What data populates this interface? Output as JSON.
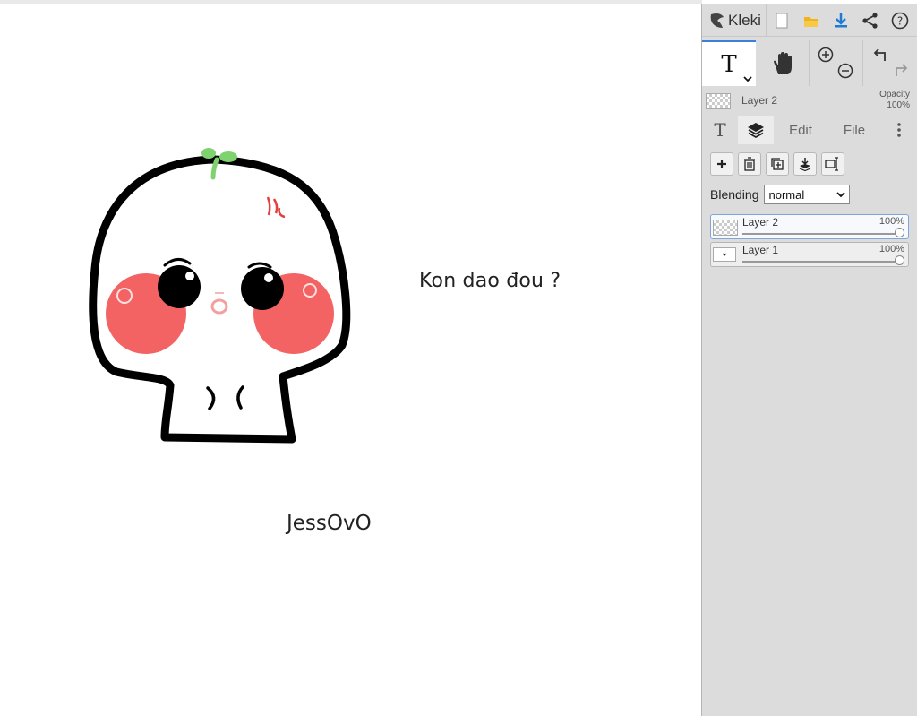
{
  "app": {
    "name": "Kleki"
  },
  "canvas": {
    "text_1": "Kon dao đou ?",
    "text_2": "JessOvO"
  },
  "toolbar": {
    "icons": [
      "new-image-icon",
      "open-folder-icon",
      "download-icon",
      "share-icon",
      "help-icon"
    ],
    "accent_color": "#3c7fd6"
  },
  "tools": {
    "active": "text",
    "text_glyph": "T"
  },
  "layer_header": {
    "name": "Layer 2",
    "opacity_label": "Opacity",
    "opacity_value": "100%"
  },
  "tabs": {
    "text_glyph": "T",
    "edit": "Edit",
    "file": "File"
  },
  "layers_panel": {
    "blending_label": "Blending",
    "blending_value": "normal",
    "layers": [
      {
        "name": "Layer 2",
        "opacity": "100%",
        "selected": true
      },
      {
        "name": "Layer 1",
        "opacity": "100%",
        "selected": false
      }
    ]
  }
}
